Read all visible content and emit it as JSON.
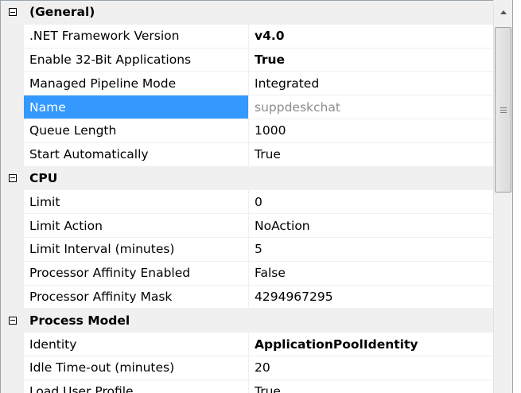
{
  "categories": [
    {
      "label": "(General)",
      "rows": [
        {
          "name": ".NET Framework Version",
          "value": "v4.0",
          "bold": true
        },
        {
          "name": "Enable 32-Bit Applications",
          "value": "True",
          "bold": true
        },
        {
          "name": "Managed Pipeline Mode",
          "value": "Integrated"
        },
        {
          "name": "Name",
          "value": "suppdeskchat",
          "selected": true,
          "readonly": true
        },
        {
          "name": "Queue Length",
          "value": "1000"
        },
        {
          "name": "Start Automatically",
          "value": "True"
        }
      ]
    },
    {
      "label": "CPU",
      "rows": [
        {
          "name": "Limit",
          "value": "0"
        },
        {
          "name": "Limit Action",
          "value": "NoAction"
        },
        {
          "name": "Limit Interval (minutes)",
          "value": "5"
        },
        {
          "name": "Processor Affinity Enabled",
          "value": "False"
        },
        {
          "name": "Processor Affinity Mask",
          "value": "4294967295"
        }
      ]
    },
    {
      "label": "Process Model",
      "rows": [
        {
          "name": "Identity",
          "value": "ApplicationPoolIdentity",
          "bold": true
        },
        {
          "name": "Idle Time-out (minutes)",
          "value": "20"
        },
        {
          "name": "Load User Profile",
          "value": "True"
        }
      ]
    }
  ],
  "colors": {
    "selection": "#3399ff",
    "gutter": "#f0f0f0",
    "readonly_text": "#8c8c8c"
  },
  "icons": {
    "collapse": "minus-box-icon",
    "scroll_up": "up-arrow-icon",
    "thumb_grip": "grip-icon"
  }
}
